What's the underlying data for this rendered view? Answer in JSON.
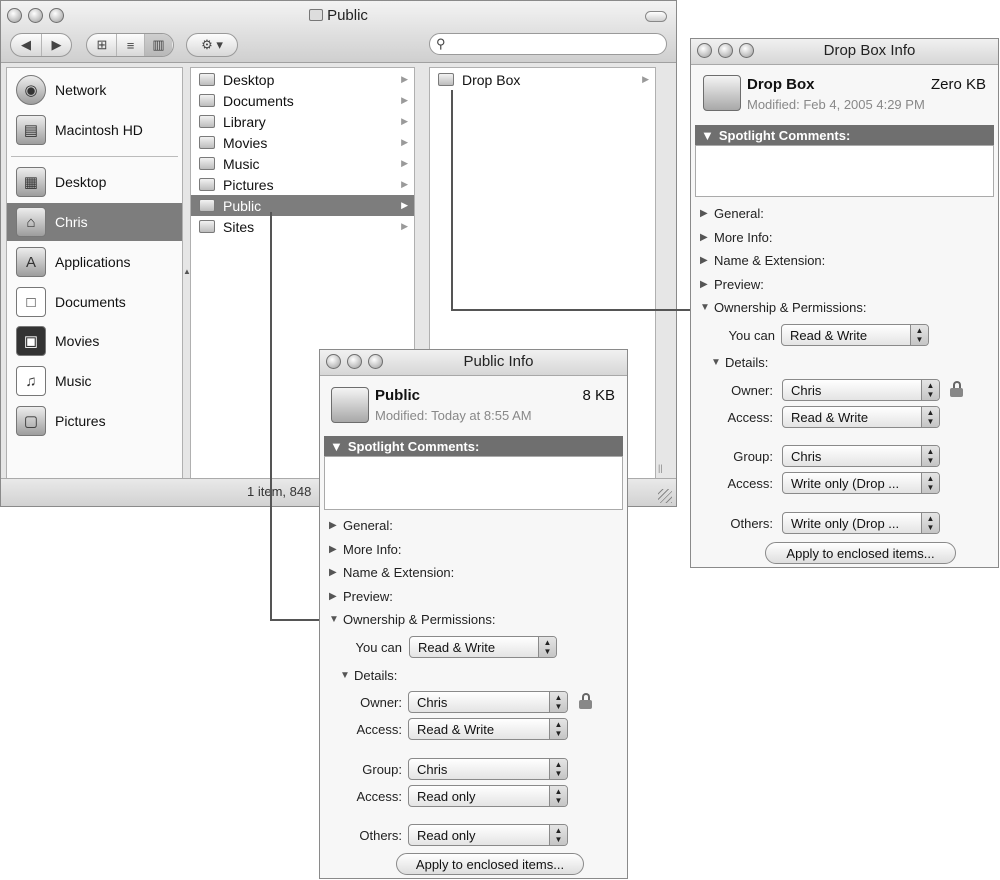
{
  "finder": {
    "title": "Public",
    "nav": {
      "back": "◀",
      "forward": "▶"
    },
    "view_icons": {
      "icon": "⊞",
      "list": "≡",
      "column": "▥"
    },
    "action_button": "⚙ ▾",
    "search": {
      "placeholder": "",
      "icon": "search-icon"
    },
    "sidebar": [
      {
        "label": "Network",
        "icon": "network-icon"
      },
      {
        "label": "Macintosh HD",
        "icon": "hard-drive-icon"
      },
      {
        "label": "Desktop",
        "icon": "desktop-icon"
      },
      {
        "label": "Chris",
        "icon": "home-icon",
        "selected": true
      },
      {
        "label": "Applications",
        "icon": "applications-icon"
      },
      {
        "label": "Documents",
        "icon": "documents-icon"
      },
      {
        "label": "Movies",
        "icon": "movies-icon"
      },
      {
        "label": "Music",
        "icon": "music-icon"
      },
      {
        "label": "Pictures",
        "icon": "pictures-icon"
      }
    ],
    "column1": [
      "Desktop",
      "Documents",
      "Library",
      "Movies",
      "Music",
      "Pictures",
      "Public",
      "Sites"
    ],
    "column1_selected": "Public",
    "column2": [
      "Drop Box"
    ],
    "status": "1 item, 848"
  },
  "public_info": {
    "title": "Public Info",
    "name": "Public",
    "size": "8 KB",
    "modified": "Modified: Today at 8:55 AM",
    "spotlight": "Spotlight Comments:",
    "sections": [
      "General:",
      "More Info:",
      "Name & Extension:",
      "Preview:"
    ],
    "ownership": "Ownership & Permissions:",
    "you_can_label": "You can",
    "you_can_value": "Read & Write",
    "details": "Details:",
    "owner_label": "Owner:",
    "owner_value": "Chris",
    "owner_access_label": "Access:",
    "owner_access_value": "Read & Write",
    "group_label": "Group:",
    "group_value": "Chris",
    "group_access_label": "Access:",
    "group_access_value": "Read only",
    "others_label": "Others:",
    "others_value": "Read only",
    "apply": "Apply to enclosed items..."
  },
  "dropbox_info": {
    "title": "Drop Box Info",
    "name": "Drop Box",
    "size": "Zero KB",
    "modified": "Modified: Feb 4, 2005 4:29 PM",
    "spotlight": "Spotlight Comments:",
    "sections": [
      "General:",
      "More Info:",
      "Name & Extension:",
      "Preview:"
    ],
    "ownership": "Ownership & Permissions:",
    "you_can_label": "You can",
    "you_can_value": "Read & Write",
    "details": "Details:",
    "owner_label": "Owner:",
    "owner_value": "Chris",
    "owner_access_label": "Access:",
    "owner_access_value": "Read & Write",
    "group_label": "Group:",
    "group_value": "Chris",
    "group_access_label": "Access:",
    "group_access_value": "Write only (Drop ...",
    "others_label": "Others:",
    "others_value": "Write only (Drop ...",
    "apply": "Apply to enclosed items..."
  }
}
